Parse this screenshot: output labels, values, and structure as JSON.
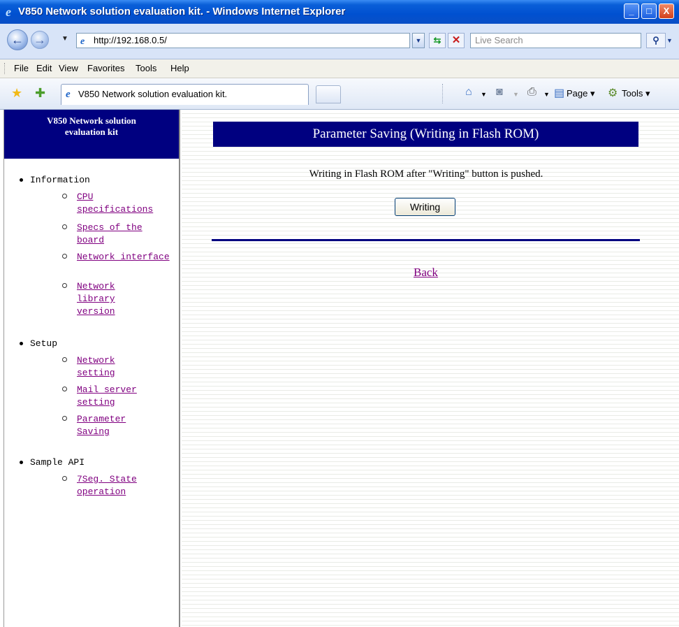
{
  "window": {
    "title": "V850 Network solution evaluation kit. - Windows Internet Explorer",
    "minimize": "_",
    "maximize": "□",
    "close": "X"
  },
  "address_bar": {
    "url": "http://192.168.0.5/",
    "search_placeholder": "Live Search"
  },
  "menu": [
    "File",
    "Edit",
    "View",
    "Favorites",
    "Tools",
    "Help"
  ],
  "tab": {
    "label": "V850 Network solution evaluation kit."
  },
  "command_bar": {
    "page": "Page",
    "tools": "Tools"
  },
  "sidebar": {
    "header": [
      "V850 Network solution",
      "evaluation kit"
    ],
    "sections": [
      {
        "label": "Information",
        "items": [
          {
            "label": "CPU specifications"
          },
          {
            "label": "Specs of the board"
          },
          {
            "label": "Network interface"
          },
          {
            "label": "Network library version"
          }
        ]
      },
      {
        "label": "Setup",
        "items": [
          {
            "label": "Network setting"
          },
          {
            "label": "Mail server setting"
          },
          {
            "label": "Parameter Saving"
          }
        ]
      },
      {
        "label": "Sample API",
        "items": [
          {
            "label": "7Seg. State operation"
          }
        ]
      }
    ]
  },
  "main": {
    "title": "Parameter Saving (Writing in Flash ROM)",
    "instruction": "Writing in Flash ROM after \"Writing\" button is pushed.",
    "button": "Writing",
    "back_link": "Back"
  }
}
